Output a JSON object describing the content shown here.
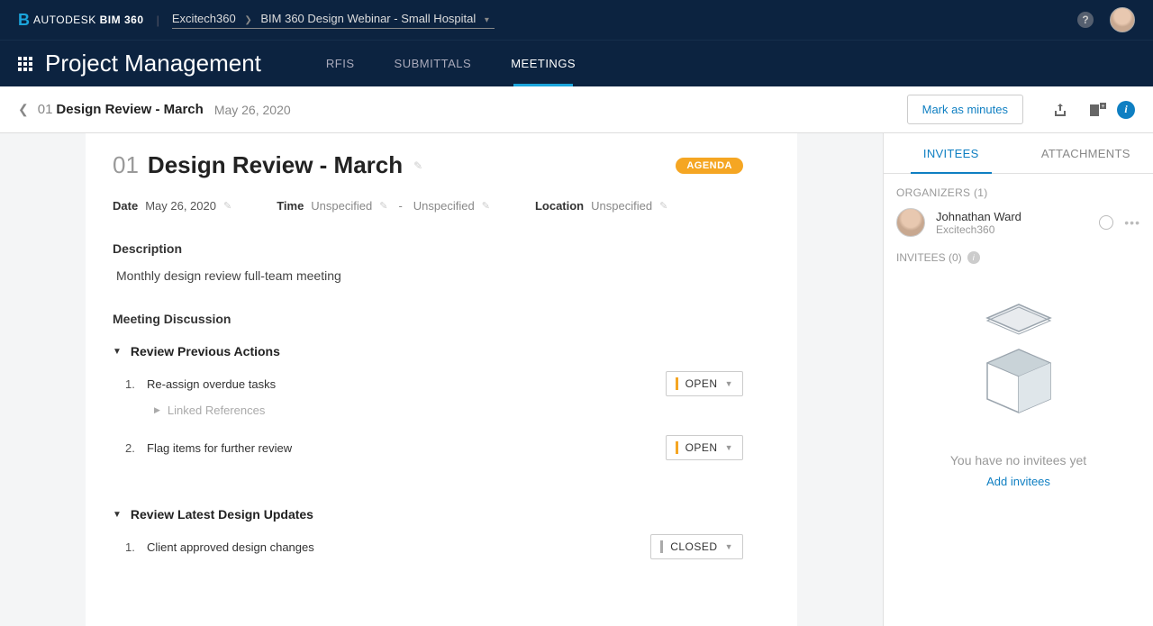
{
  "brand": {
    "name_prefix": "AUTODESK",
    "name": "BIM 360"
  },
  "breadcrumb": {
    "org": "Excitech360",
    "project": "BIM 360 Design Webinar - Small Hospital"
  },
  "module": {
    "title": "Project Management"
  },
  "tabs": {
    "rfis": "RFIS",
    "submittals": "SUBMITTALS",
    "meetings": "MEETINGS"
  },
  "page_bar": {
    "number": "01",
    "title": "Design Review - March",
    "date": "May 26, 2020",
    "mark_minutes": "Mark as minutes"
  },
  "meeting": {
    "number": "01",
    "title": "Design Review - March",
    "badge": "AGENDA",
    "date_label": "Date",
    "date_value": "May 26, 2020",
    "time_label": "Time",
    "time_value": "Unspecified",
    "time_end": "Unspecified",
    "location_label": "Location",
    "location_value": "Unspecified",
    "description_label": "Description",
    "description": "Monthly design review full-team meeting",
    "discussion_label": "Meeting Discussion",
    "topics": [
      {
        "title": "Review Previous Actions",
        "items": [
          {
            "num": "1.",
            "text": "Re-assign overdue tasks",
            "status": "OPEN",
            "status_type": "open",
            "linked": "Linked References"
          },
          {
            "num": "2.",
            "text": "Flag items for further review",
            "status": "OPEN",
            "status_type": "open"
          }
        ]
      },
      {
        "title": "Review Latest Design Updates",
        "items": [
          {
            "num": "1.",
            "text": "Client approved design changes",
            "status": "CLOSED",
            "status_type": "closed"
          }
        ]
      }
    ]
  },
  "right": {
    "tab_invitees": "INVITEES",
    "tab_attachments": "ATTACHMENTS",
    "organizers_label": "ORGANIZERS (1)",
    "organizers": [
      {
        "name": "Johnathan Ward",
        "company": "Excitech360"
      }
    ],
    "invitees_label": "INVITEES (0)",
    "empty_msg": "You have no invitees yet",
    "add_link": "Add invitees"
  }
}
